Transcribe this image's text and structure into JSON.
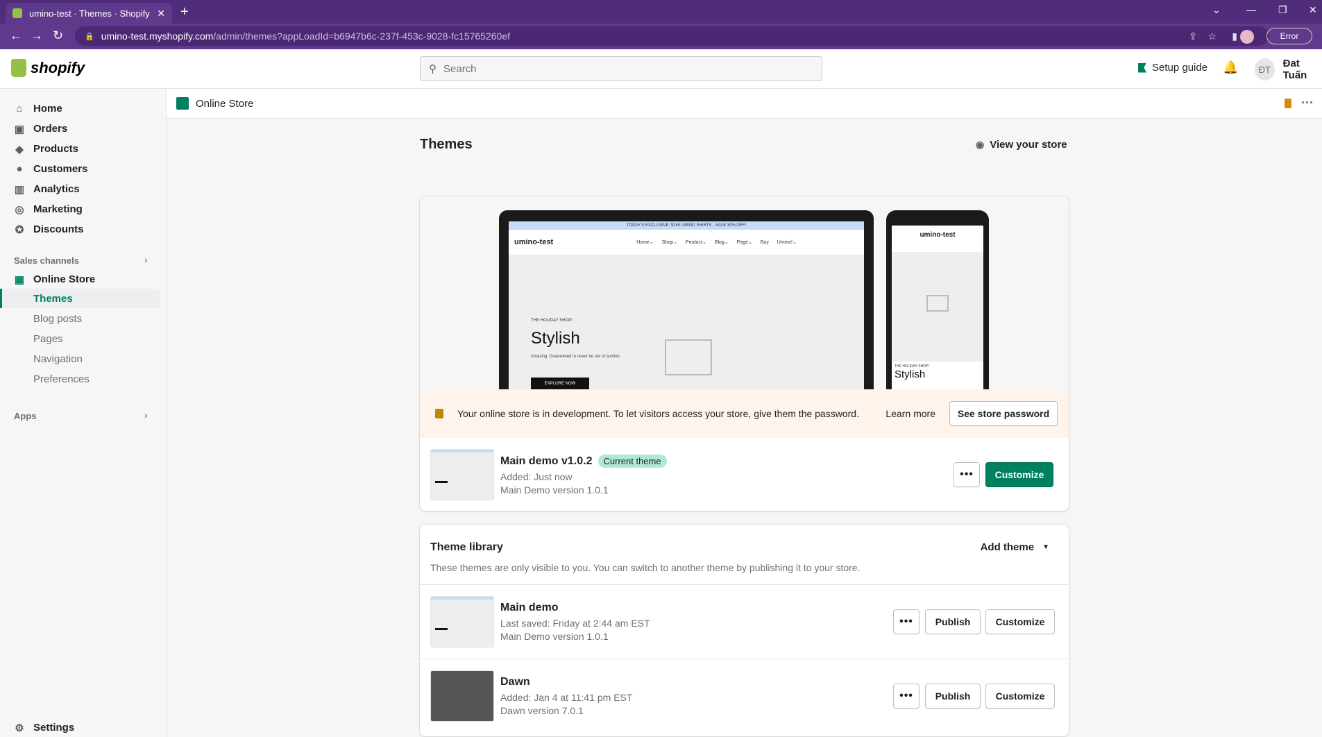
{
  "browser": {
    "tab_title": "umino-test · Themes · Shopify",
    "url_host": "umino-test.myshopify.com",
    "url_path": "/admin/themes?appLoadId=b6947b6c-237f-453c-9028-fc15765260ef",
    "error_label": "Error"
  },
  "topbar": {
    "logo_text": "shopify",
    "search_placeholder": "Search",
    "setup_guide": "Setup guide",
    "user_initials": "ĐT",
    "user_name": "Đat Tuấn"
  },
  "sidebar": {
    "items": [
      {
        "label": "Home",
        "icon": "home-icon"
      },
      {
        "label": "Orders",
        "icon": "orders-icon"
      },
      {
        "label": "Products",
        "icon": "tag-icon"
      },
      {
        "label": "Customers",
        "icon": "person-icon"
      },
      {
        "label": "Analytics",
        "icon": "chart-icon"
      },
      {
        "label": "Marketing",
        "icon": "target-icon"
      },
      {
        "label": "Discounts",
        "icon": "discount-icon"
      }
    ],
    "sales_channels_label": "Sales channels",
    "online_store_label": "Online Store",
    "sub_items": [
      "Themes",
      "Blog posts",
      "Pages",
      "Navigation",
      "Preferences"
    ],
    "apps_label": "Apps",
    "settings_label": "Settings"
  },
  "breadcrumb": {
    "label": "Online Store"
  },
  "page": {
    "title": "Themes",
    "view_store": "View your store"
  },
  "preview": {
    "announce": "TODAY'S EXCLUSIVE: $150 UMINO SHIRTS - SALE 30% OFF!",
    "store_name": "umino-test",
    "nav": "Home⌄ Shop⌄ Product⌄ Blog⌄ Page⌄ Buy Umino!⌄",
    "hero_small": "THE HOLIDAY SHOP!",
    "hero_big": "Stylish",
    "hero_sub": "Amazing. Guaranteed to never be out of fashion.",
    "hero_btn": "EXPLORE NOW",
    "phone_store_name": "umino-test"
  },
  "banner": {
    "message": "Your online store is in development. To let visitors access your store, give them the password.",
    "learn_more": "Learn more",
    "button": "See store password"
  },
  "current_theme": {
    "name": "Main demo v1.0.2",
    "badge": "Current theme",
    "added": "Added: Just now",
    "version": "Main Demo version 1.0.1",
    "more_label": "•••",
    "customize": "Customize"
  },
  "library": {
    "title": "Theme library",
    "description": "These themes are only visible to you. You can switch to another theme by publishing it to your store.",
    "add_theme": "Add theme",
    "themes": [
      {
        "name": "Main demo",
        "meta1": "Last saved: Friday at 2:44 am EST",
        "meta2": "Main Demo version 1.0.1",
        "more": "•••",
        "publish": "Publish",
        "customize": "Customize"
      },
      {
        "name": "Dawn",
        "meta1": "Added: Jan 4 at 11:41 pm EST",
        "meta2": "Dawn version 7.0.1",
        "more": "•••",
        "publish": "Publish",
        "customize": "Customize"
      }
    ]
  },
  "colors": {
    "primary": "#008060",
    "browser": "#5f3a8c",
    "banner": "#fff4ec",
    "badge": "#aee9d1"
  }
}
